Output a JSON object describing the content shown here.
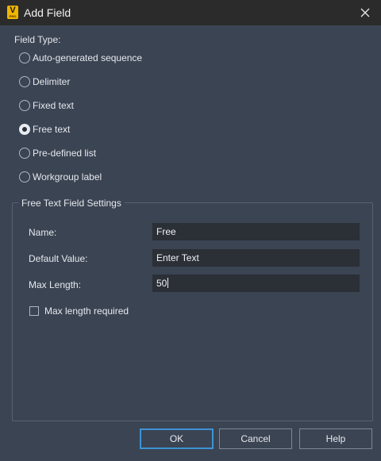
{
  "window": {
    "title": "Add Field",
    "icon_letter": "V",
    "icon_sub": "PRO"
  },
  "field_type": {
    "label": "Field Type:",
    "selected": "Free text",
    "options": [
      {
        "label": "Auto-generated sequence",
        "checked": false
      },
      {
        "label": "Delimiter",
        "checked": false
      },
      {
        "label": "Fixed text",
        "checked": false
      },
      {
        "label": "Free text",
        "checked": true
      },
      {
        "label": "Pre-defined list",
        "checked": false
      },
      {
        "label": "Workgroup label",
        "checked": false
      }
    ]
  },
  "settings": {
    "legend": "Free Text Field Settings",
    "name_label": "Name:",
    "name_value": "Free",
    "default_label": "Default Value:",
    "default_value": "Enter Text",
    "maxlen_label": "Max Length:",
    "maxlen_value": "50",
    "maxlen_required_label": "Max length required",
    "maxlen_required_checked": false
  },
  "buttons": {
    "ok": "OK",
    "cancel": "Cancel",
    "help": "Help"
  },
  "colors": {
    "background": "#3b4453",
    "titlebar": "#2b2b2b",
    "input_bg": "#2b2f36",
    "accent": "#3d93d4",
    "icon_yellow": "#f0b400"
  }
}
